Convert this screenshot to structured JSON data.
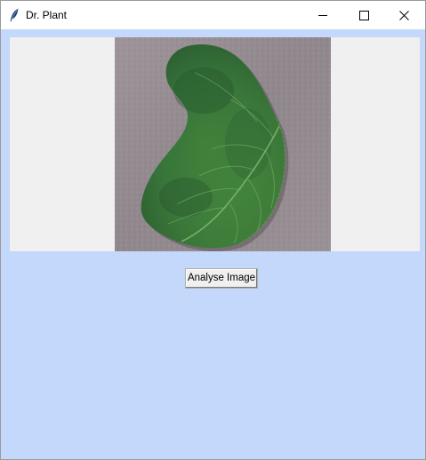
{
  "window": {
    "title": "Dr. Plant",
    "app_icon": "feather-icon"
  },
  "titlebar_controls": {
    "minimize": "minimize-icon",
    "maximize": "maximize-icon",
    "close": "close-icon"
  },
  "main": {
    "background_color": "#c3d8fb",
    "image_panel_color": "#f0f0f0",
    "analyse_button_label": "Analyse Image"
  }
}
